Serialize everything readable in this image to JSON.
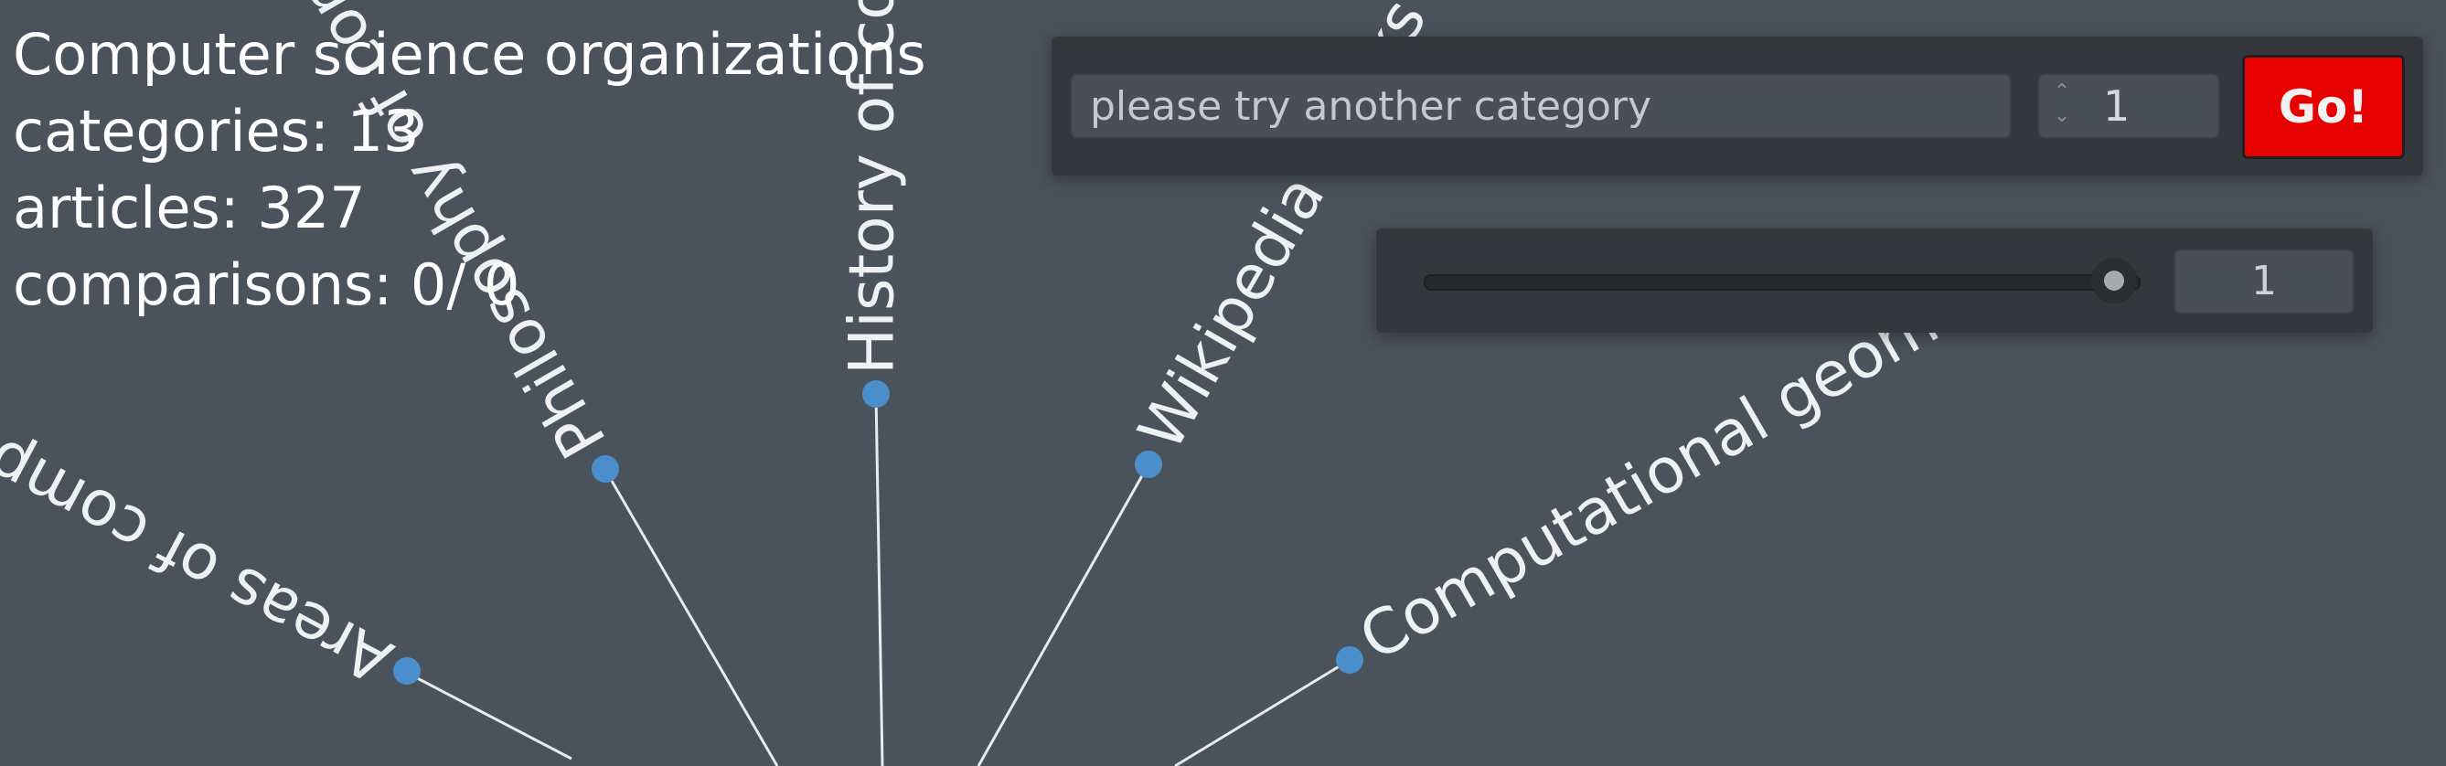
{
  "stats": {
    "title": "Computer science organizations",
    "categories": "categories: 13",
    "articles": "articles: 327",
    "comparisons": "comparisons: 0/ 0"
  },
  "search": {
    "placeholder": "please try another category",
    "depth_value": "1",
    "go_label": "Go!"
  },
  "slider": {
    "value": "1",
    "fraction": 1.0
  },
  "graph": {
    "node_labels": [
      "Areas of computer science",
      "Philosophy of computer science",
      "History of computer science",
      "Wikipedia books on computer science",
      "Computational geometry"
    ],
    "edge_color": "#e8eaec",
    "node_color": "#4a8fcc"
  },
  "colors": {
    "background": "#4a525b",
    "panel": "#34383d",
    "go_button": "#e60000"
  }
}
